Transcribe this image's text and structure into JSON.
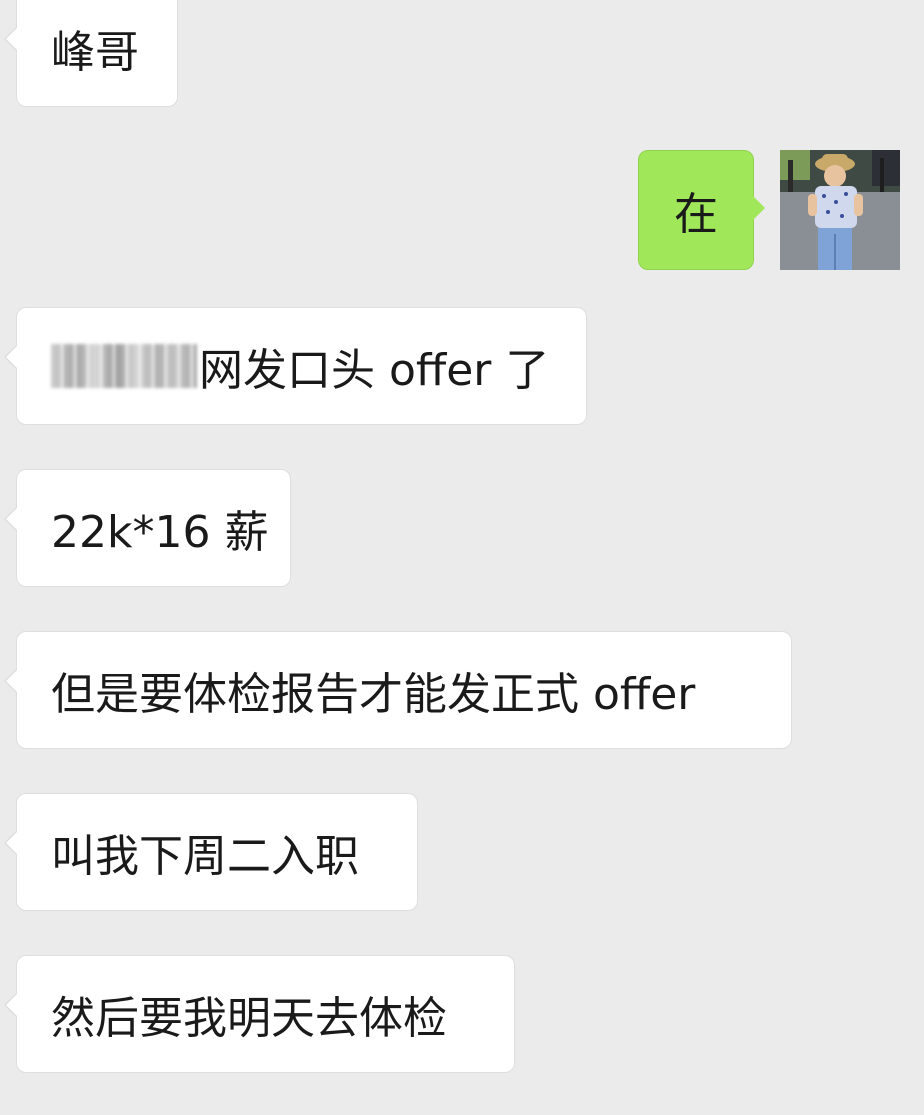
{
  "messages": [
    {
      "side": "left",
      "text": "峰哥"
    },
    {
      "side": "right",
      "text": "在"
    },
    {
      "side": "left",
      "text": "网发口头 offer 了",
      "redacted_prefix": true
    },
    {
      "side": "left",
      "text": "22k*16 薪"
    },
    {
      "side": "left",
      "text": "但是要体检报告才能发正式 offer"
    },
    {
      "side": "left",
      "text": "叫我下周二入职"
    },
    {
      "side": "left",
      "text": "然后要我明天去体检"
    }
  ],
  "colors": {
    "background": "#ebebeb",
    "received_bubble": "#ffffff",
    "sent_bubble": "#a0e75a",
    "text": "#1a1a1a"
  },
  "avatar": {
    "icon": "child-photo-avatar"
  }
}
